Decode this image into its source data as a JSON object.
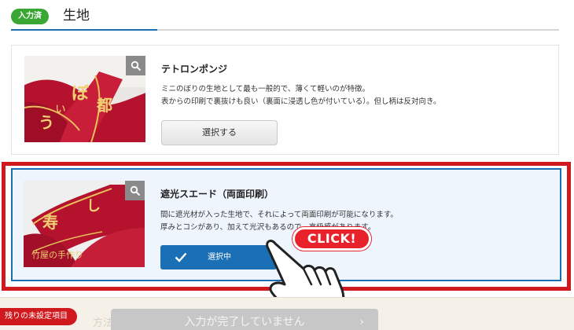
{
  "section": {
    "badge": "入力済",
    "title": "生地"
  },
  "options": [
    {
      "title": "テトロンポンジ",
      "desc_line1": "ミニのぼりの生地として最も一般的で、薄くて軽いのが特徴。",
      "desc_line2": "表からの印刷で裏抜けも良い（裏面に浸透し色が付いている）。但し柄は反対向き。",
      "button_label": "選択する",
      "zoom_icon": "magnifier-icon"
    },
    {
      "title": "遮光スエード（両面印刷）",
      "desc_line1": "間に遮光材が入った生地で、それによって両面印刷が可能になります。",
      "desc_line2": "厚みとコシがあり、加えて光沢もあるので、高級感があります。",
      "button_label": "選択中",
      "zoom_icon": "magnifier-icon",
      "selected": true
    }
  ],
  "callout": {
    "text": "CLICK!"
  },
  "bottom": {
    "remaining_label": "残りの未設定項目",
    "hint": "方法",
    "incomplete_button": "入力が完了していません",
    "arrow": "›"
  },
  "colors": {
    "accent_blue": "#1a6fb5",
    "badge_green": "#3aa735",
    "highlight_red": "#d0191e",
    "cloth_red": "#b5132d",
    "print_gold": "#e7c15a"
  }
}
